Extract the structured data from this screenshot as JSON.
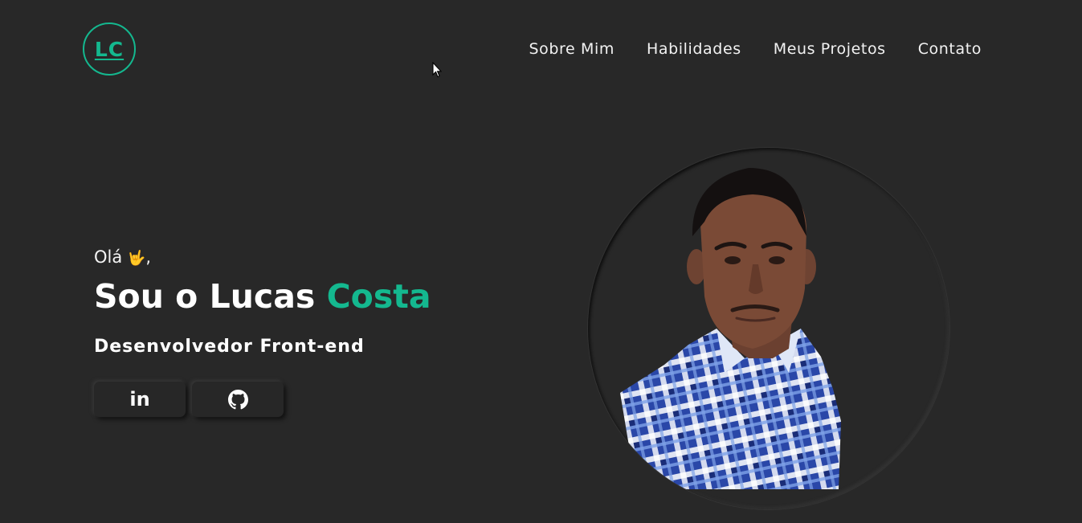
{
  "logo": {
    "text": "LC"
  },
  "nav": {
    "items": [
      {
        "label": "Sobre Mim"
      },
      {
        "label": "Habilidades"
      },
      {
        "label": "Meus Projetos"
      },
      {
        "label": "Contato"
      }
    ]
  },
  "hero": {
    "greeting_prefix": "Olá",
    "greeting_emoji": "🤟",
    "greeting_suffix": ",",
    "headline_prefix": "Sou o Lucas ",
    "headline_accent": "Costa",
    "subtitle": "Desenvolvedor Front-end"
  },
  "socials": {
    "linkedin_glyph": "in",
    "linkedin_icon": "linkedin-icon",
    "github_icon": "github-icon"
  },
  "colors": {
    "background": "#282828",
    "accent": "#14b88f",
    "text": "#ffffff"
  }
}
